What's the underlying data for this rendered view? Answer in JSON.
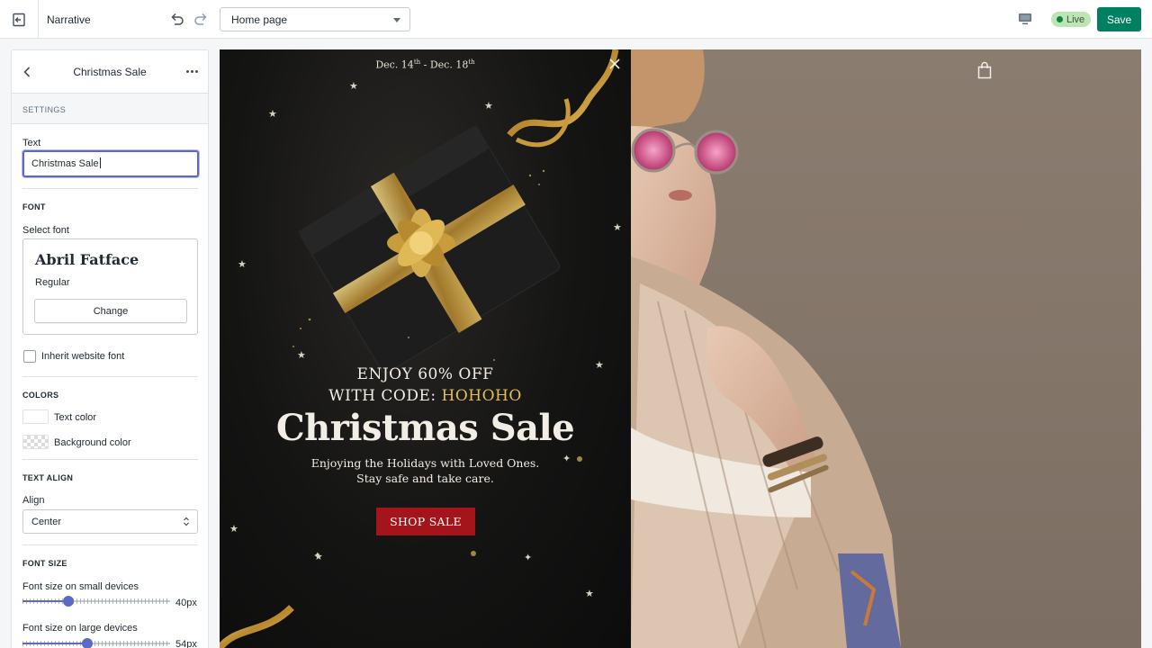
{
  "topbar": {
    "theme_name": "Narrative",
    "page_selector": "Home page",
    "live_label": "Live",
    "save_label": "Save"
  },
  "sidebar": {
    "title": "Christmas Sale",
    "section_header": "SETTINGS",
    "text_label": "Text",
    "text_value": "Christmas Sale",
    "font_caption": "FONT",
    "select_font_label": "Select font",
    "font_name": "Abril Fatface",
    "font_style": "Regular",
    "change_label": "Change",
    "inherit_label": "Inherit website font",
    "inherit_checked": false,
    "colors_caption": "COLORS",
    "text_color_label": "Text color",
    "text_color": "#ffffff",
    "bg_color_label": "Background color",
    "align_caption": "TEXT ALIGN",
    "align_label": "Align",
    "align_value": "Center",
    "font_size_caption": "FONT SIZE",
    "small_label": "Font size on small devices",
    "small_value": "40px",
    "small_fraction": 0.31,
    "large_label": "Font size on large devices",
    "large_value": "54px",
    "large_fraction": 0.44
  },
  "preview": {
    "date_start": "Dec. 14",
    "date_start_sup": "th",
    "date_sep": " - Dec. 18",
    "date_end_sup": "th",
    "offer_line1": "ENJOY 60% OFF",
    "offer_line2_prefix": "WITH CODE: ",
    "offer_code": "HOHOHO",
    "headline": "Christmas Sale",
    "sub_line1": "Enjoying the Holidays with Loved Ones.",
    "sub_line2": "Stay safe and take care.",
    "cta_label": "SHOP SALE"
  },
  "colors": {
    "accent": "#5c6ac4",
    "save": "#008060",
    "live": "#bbe5b3",
    "gold": "#e0bf5a",
    "cta": "#a3141b"
  },
  "icons": [
    "exit-icon",
    "undo-icon",
    "redo-icon",
    "chevron-down-icon",
    "desktop-icon",
    "back-arrow-icon",
    "more-icon",
    "select-arrows-icon",
    "close-icon",
    "shopping-bag-icon"
  ]
}
